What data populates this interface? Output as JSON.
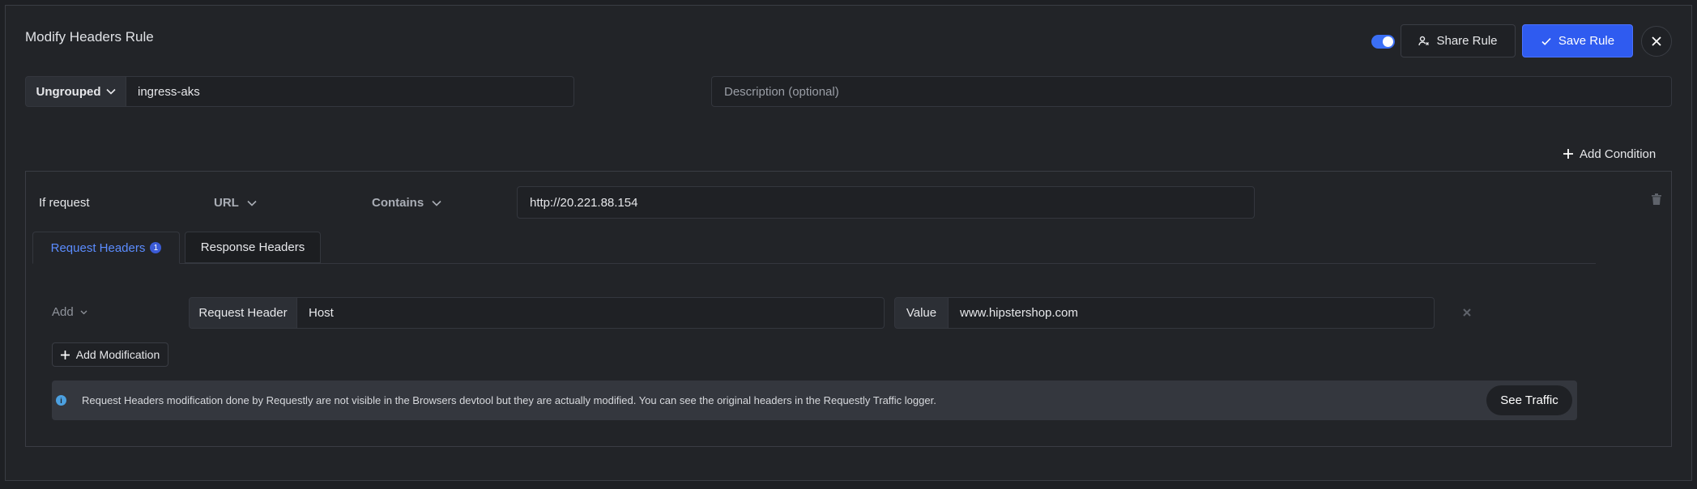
{
  "header": {
    "title": "Modify Headers Rule",
    "status_toggle": "on",
    "share_label": "Share Rule",
    "save_label": "Save Rule"
  },
  "rule": {
    "group": "Ungrouped",
    "name": "ingress-aks",
    "description_placeholder": "Description (optional)",
    "add_condition_label": "Add Condition"
  },
  "condition": {
    "if_label": "If request",
    "source_key": "URL",
    "operator": "Contains",
    "value": "http://20.221.88.154"
  },
  "tabs": [
    {
      "label": "Request Headers",
      "count": "1",
      "active": true
    },
    {
      "label": "Response Headers",
      "active": false
    }
  ],
  "modification": {
    "action": "Add",
    "header_label": "Request Header",
    "header_name": "Host",
    "value_label": "Value",
    "value": "www.hipstershop.com",
    "add_modification_label": "Add Modification"
  },
  "info_banner": {
    "text": "Request Headers modification done by Requestly are not visible in the Browsers devtool but they are actually modified. You can see the original headers in the Requestly Traffic logger.",
    "button_label": "See Traffic"
  },
  "colors": {
    "background": "#222428",
    "accent": "#2f5bf0",
    "active_tab": "#5b8cff"
  }
}
